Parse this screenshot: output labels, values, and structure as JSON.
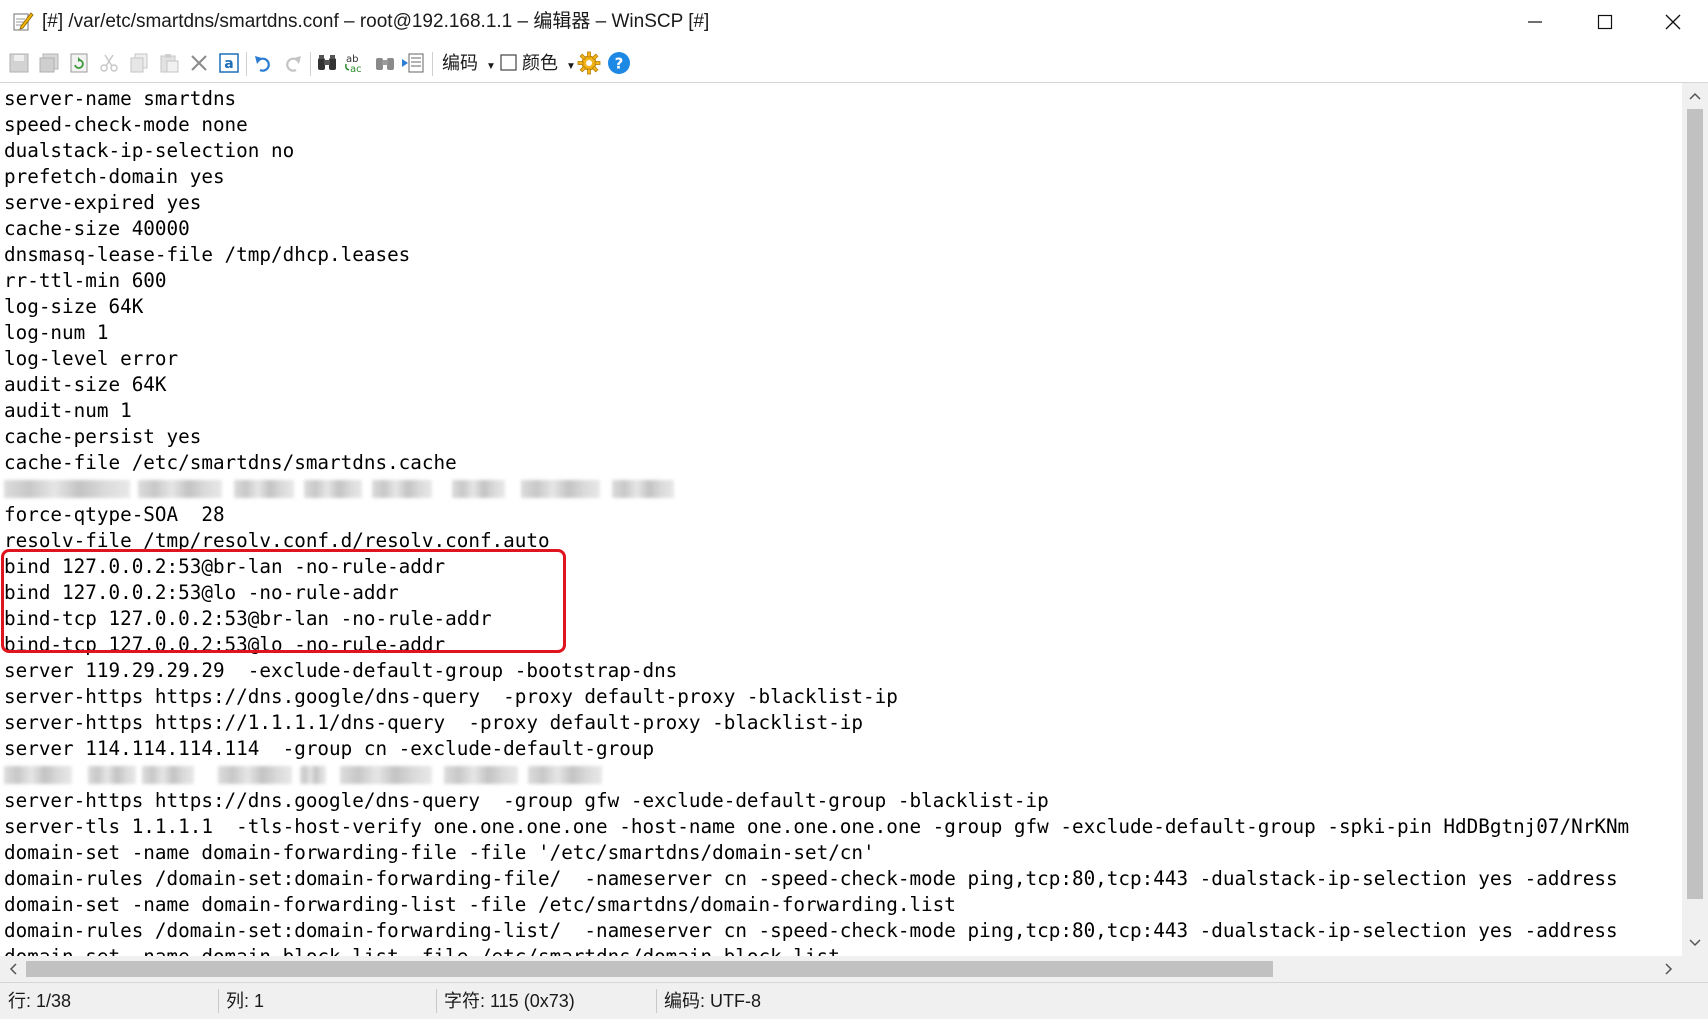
{
  "window": {
    "title": "[#] /var/etc/smartdns/smartdns.conf – root@192.168.1.1 – 编辑器 – WinSCP [#]"
  },
  "toolbar": {
    "encoding_label": "编码",
    "color_label": "颜色"
  },
  "editor": {
    "lines": [
      "server-name smartdns",
      "speed-check-mode none",
      "dualstack-ip-selection no",
      "prefetch-domain yes",
      "serve-expired yes",
      "cache-size 40000",
      "dnsmasq-lease-file /tmp/dhcp.leases",
      "rr-ttl-min 600",
      "log-size 64K",
      "log-num 1",
      "log-level error",
      "audit-size 64K",
      "audit-num 1",
      "cache-persist yes",
      "cache-file /etc/smartdns/smartdns.cache",
      "",
      "force-qtype-SOA  28",
      "resolv-file /tmp/resolv.conf.d/resolv.conf.auto",
      "bind 127.0.0.2:53@br-lan -no-rule-addr",
      "bind 127.0.0.2:53@lo -no-rule-addr",
      "bind-tcp 127.0.0.2:53@br-lan -no-rule-addr",
      "bind-tcp 127.0.0.2:53@lo -no-rule-addr",
      "server 119.29.29.29  -exclude-default-group -bootstrap-dns",
      "server-https https://dns.google/dns-query  -proxy default-proxy -blacklist-ip",
      "server-https https://1.1.1.1/dns-query  -proxy default-proxy -blacklist-ip",
      "server 114.114.114.114  -group cn -exclude-default-group",
      "",
      "server-https https://dns.google/dns-query  -group gfw -exclude-default-group -blacklist-ip",
      "server-tls 1.1.1.1  -tls-host-verify one.one.one.one -host-name one.one.one.one -group gfw -exclude-default-group -spki-pin HdDBgtnj07/NrKNm",
      "domain-set -name domain-forwarding-file -file '/etc/smartdns/domain-set/cn'",
      "domain-rules /domain-set:domain-forwarding-file/  -nameserver cn -speed-check-mode ping,tcp:80,tcp:443 -dualstack-ip-selection yes -address",
      "domain-set -name domain-forwarding-list -file /etc/smartdns/domain-forwarding.list",
      "domain-rules /domain-set:domain-forwarding-list/  -nameserver cn -speed-check-mode ping,tcp:80,tcp:443 -dualstack-ip-selection yes -address",
      "domain-set -name domain-block-list -file /etc/smartdns/domain-block.list"
    ]
  },
  "statusbar": {
    "line": "行: 1/38",
    "column": "列: 1",
    "char": "字符: 115 (0x73)",
    "encoding": "编码: UTF-8"
  },
  "colors": {
    "highlight_border": "#e0141e",
    "help_icon": "#1e88e5"
  }
}
